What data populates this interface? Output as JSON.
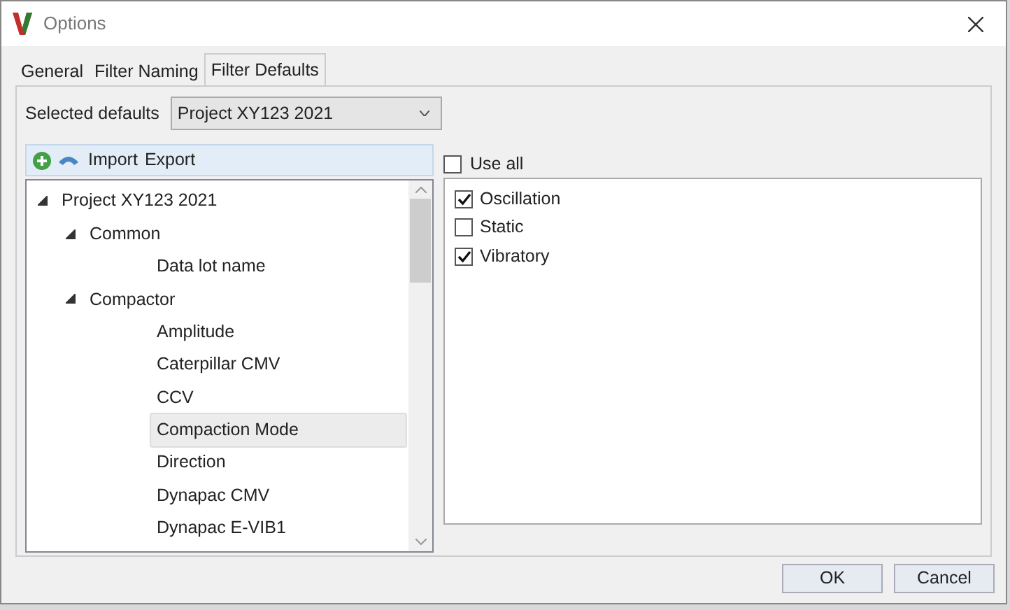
{
  "window": {
    "title": "Options"
  },
  "tabs": [
    {
      "label": "General",
      "selected": false
    },
    {
      "label": "Filter Naming",
      "selected": false
    },
    {
      "label": "Filter Defaults",
      "selected": true
    }
  ],
  "selected_defaults": {
    "label": "Selected defaults",
    "value": "Project XY123 2021"
  },
  "toolbar": {
    "buttons": [
      "Import",
      "Export"
    ]
  },
  "tree": [
    {
      "label": "Project XY123 2021",
      "expanded": true,
      "selected": false,
      "children": [
        {
          "label": "Common",
          "expanded": true,
          "selected": false,
          "children": [
            {
              "label": "Data lot name",
              "selected": false
            }
          ]
        },
        {
          "label": "Compactor",
          "expanded": true,
          "selected": false,
          "children": [
            {
              "label": "Amplitude",
              "selected": false
            },
            {
              "label": "Caterpillar CMV",
              "selected": false
            },
            {
              "label": "CCV",
              "selected": false
            },
            {
              "label": "Compaction Mode",
              "selected": true
            },
            {
              "label": "Direction",
              "selected": false
            },
            {
              "label": "Dynapac CMV",
              "selected": false
            },
            {
              "label": "Dynapac E-VIB1",
              "selected": false
            }
          ]
        }
      ]
    }
  ],
  "use_all": {
    "label": "Use all",
    "checked": false
  },
  "values": [
    {
      "label": "Oscillation",
      "checked": true
    },
    {
      "label": "Static",
      "checked": false
    },
    {
      "label": "Vibratory",
      "checked": true
    }
  ],
  "buttons": [
    "OK",
    "Cancel"
  ]
}
